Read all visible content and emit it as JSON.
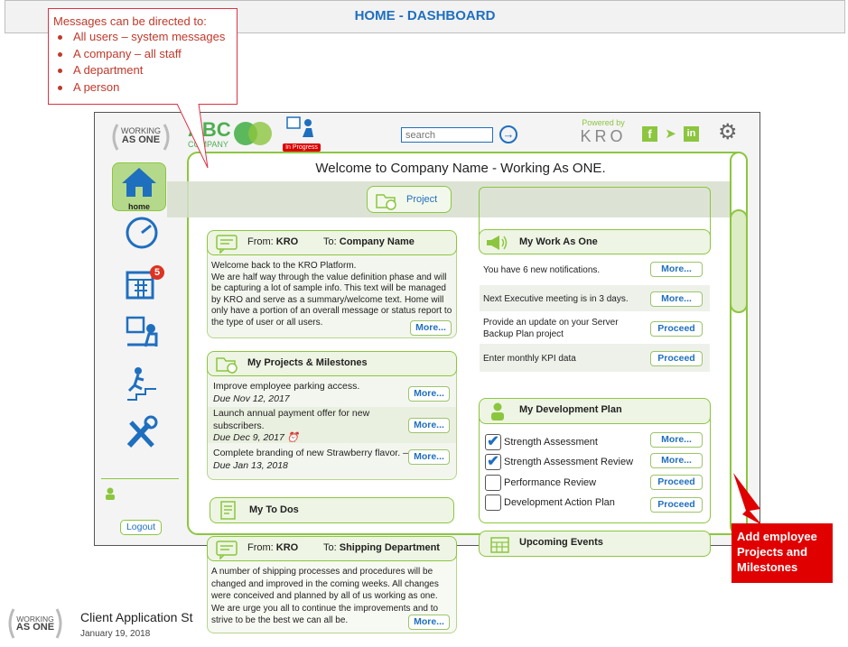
{
  "header": {
    "title": "HOME - DASHBOARD"
  },
  "callout": {
    "intro": "Messages can be directed to:",
    "items": [
      "All users – system messages",
      "A company – all staff",
      "A department",
      "A person"
    ]
  },
  "app": {
    "logo_line1": "WORKING",
    "logo_line2": "AS ONE",
    "company_logo": "ABC",
    "company_sub": "COMPANY",
    "status_badge": "In Progress",
    "search_placeholder": "search",
    "powered_by": "Powered by",
    "kro_logo": "KRO",
    "welcome": "Welcome to Company Name - Working As ONE."
  },
  "sidebar": {
    "items": [
      {
        "icon": "home-icon",
        "label": "home"
      },
      {
        "icon": "dashboard-gauge-icon"
      },
      {
        "icon": "calendar-icon",
        "badge": "5"
      },
      {
        "icon": "presentation-icon"
      },
      {
        "icon": "climbing-stairs-icon"
      },
      {
        "icon": "tools-icon"
      }
    ],
    "logout": "Logout"
  },
  "project_tab": {
    "label": "Project"
  },
  "message1": {
    "from_label": "From:",
    "from": "KRO",
    "to_label": "To:",
    "to": "Company Name",
    "body": "Welcome back to the KRO Platform.\nWe are half way through the value definition phase and will be capturing a lot of sample info.  This text will be managed by KRO and serve as a summary/welcome text. Home will only have a portion of an overall message or status report to the type of user or all users.",
    "more": "More..."
  },
  "projects": {
    "title": "My Projects & Milestones",
    "items": [
      {
        "text": "Improve employee parking access.",
        "due": "Due Nov 12, 2017",
        "more": "More..."
      },
      {
        "text": "Launch annual payment offer for new subscribers.",
        "due": "Due Dec 9, 2017",
        "more": "More..."
      },
      {
        "text": "Complete branding of new Strawberry flavor. –",
        "due": "Due Jan 13, 2018",
        "more": "More..."
      }
    ]
  },
  "todos": {
    "title": "My To Dos"
  },
  "message2": {
    "from_label": "From:",
    "from": "KRO",
    "to_label": "To:",
    "to": "Shipping Department",
    "body": "A number of shipping processes and procedures will be changed and improved in the coming weeks.  All changes were conceived and planned by all of us working as one. We are urge you all to continue the improvements and to strive to be the best we can all be.",
    "more": "More..."
  },
  "work": {
    "title": "My Work As One",
    "items": [
      {
        "text": "You have 6 new notifications.",
        "action": "More..."
      },
      {
        "text": "Next Executive meeting is in 3 days.",
        "action": "More..."
      },
      {
        "text": "Provide an update on your Server Backup Plan project",
        "action": "Proceed"
      },
      {
        "text": "Enter monthly KPI data",
        "action": "Proceed"
      }
    ]
  },
  "devplan": {
    "title": "My Development Plan",
    "items": [
      {
        "text": "Strength Assessment",
        "checked": true,
        "action": "More..."
      },
      {
        "text": "Strength Assessment Review",
        "checked": true,
        "action": "More..."
      },
      {
        "text": "Performance Review",
        "checked": false,
        "action": "Proceed"
      },
      {
        "text": "Development Action Plan",
        "checked": false,
        "action": "Proceed"
      }
    ]
  },
  "events": {
    "title": "Upcoming Events"
  },
  "annotation": {
    "text": "Add employee Projects and Milestones"
  },
  "footer": {
    "logo_line1": "WORKING",
    "logo_line2": "AS ONE",
    "title": "Client Application St",
    "date": "January 19, 2018"
  },
  "colors": {
    "brand_green": "#8cc63f",
    "link_blue": "#1f6fbf",
    "alert_red": "#e00000"
  }
}
